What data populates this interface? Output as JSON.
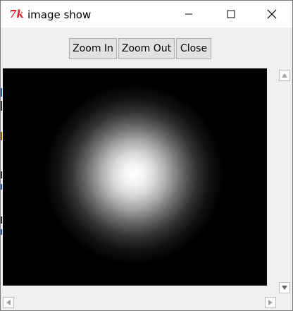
{
  "window": {
    "title": "image show",
    "icon": "tk-feather-icon",
    "icon_glyph": "7k",
    "icon_color": "#d8262b"
  },
  "titlebar": {
    "minimize_icon": "minimize-icon",
    "maximize_icon": "maximize-icon",
    "close_icon": "close-icon"
  },
  "toolbar": {
    "zoom_in_label": "Zoom In",
    "zoom_out_label": "Zoom Out",
    "close_label": "Close"
  },
  "canvas": {
    "description_image": "radial-glow",
    "background": "#000000",
    "glow_color": "#ffffff"
  },
  "scrollbars": {
    "vertical_up_icon": "arrow-up-icon",
    "vertical_down_icon": "arrow-down-icon",
    "horizontal_left_icon": "arrow-left-icon",
    "horizontal_right_icon": "arrow-right-icon"
  }
}
